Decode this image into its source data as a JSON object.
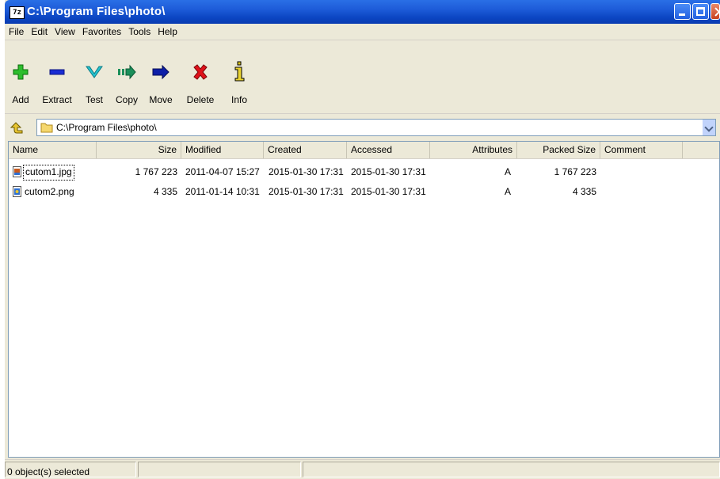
{
  "window": {
    "title": "C:\\Program Files\\photo\\",
    "app_icon_text": "7z",
    "accent_color": "#0b45c2"
  },
  "menu": [
    "File",
    "Edit",
    "View",
    "Favorites",
    "Tools",
    "Help"
  ],
  "toolbar": {
    "add": "Add",
    "extract": "Extract",
    "test": "Test",
    "copy": "Copy",
    "move": "Move",
    "delete": "Delete",
    "info": "Info"
  },
  "address": {
    "path": "C:\\Program Files\\photo\\"
  },
  "columns": [
    "Name",
    "Size",
    "Modified",
    "Created",
    "Accessed",
    "Attributes",
    "Packed Size",
    "Comment"
  ],
  "files": [
    {
      "name": "cutom1.jpg",
      "size": "1 767 223",
      "modified": "2011-04-07 15:27",
      "created": "2015-01-30 17:31",
      "accessed": "2015-01-30 17:31",
      "attributes": "A",
      "packed_size": "1 767 223",
      "comment": ""
    },
    {
      "name": "cutom2.png",
      "size": "4 335",
      "modified": "2011-01-14 10:31",
      "created": "2015-01-30 17:31",
      "accessed": "2015-01-30 17:31",
      "attributes": "A",
      "packed_size": "4 335",
      "comment": ""
    }
  ],
  "status": {
    "selection": "0 object(s) selected"
  }
}
